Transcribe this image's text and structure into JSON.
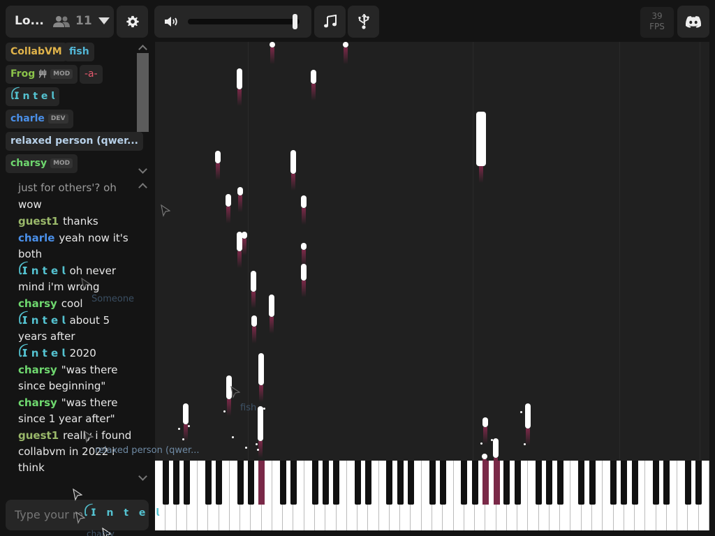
{
  "header": {
    "room_name": "Lo...",
    "user_count": "11",
    "fps_value": "39",
    "fps_label": "FPS",
    "volume_percent": 98
  },
  "icons": {
    "users": "users-icon",
    "dropdown": "chevron-down-icon",
    "settings": "gear-icon",
    "volume": "speaker-icon",
    "instrument": "music-note-icon",
    "midi": "usb-icon",
    "discord": "discord-icon"
  },
  "users": [
    {
      "name": "CollabVM",
      "color": "#e0b34a",
      "badge": ""
    },
    {
      "name": "fish",
      "color": "#52b6d6",
      "badge": ""
    },
    {
      "name": "Frog",
      "color": "#8bc34a",
      "badge": "MOD",
      "flair": "⾋"
    },
    {
      "name": "-a-",
      "color": "#e65a6e",
      "badge": ""
    },
    {
      "name": "ꪶ𝗜 𝗻 𝘁 𝗲 𝗹",
      "color": "#54c2d0",
      "badge": ""
    },
    {
      "name": "charle",
      "color": "#4a8fe8",
      "badge": "DEV"
    },
    {
      "name": "relaxed person (qwer...",
      "color": "#b7d0e8",
      "badge": ""
    },
    {
      "name": "charsy",
      "color": "#6fd86f",
      "badge": "MOD"
    }
  ],
  "chat": [
    {
      "name": "",
      "text": "just for others'? oh",
      "color": "",
      "partial": true
    },
    {
      "name": "",
      "text": "wow",
      "color": ""
    },
    {
      "name": "guest1",
      "text": "thanks",
      "color": "#9ab86a"
    },
    {
      "name": "charle",
      "text": "yeah now it's both",
      "color": "#4a8fe8"
    },
    {
      "name": "ꪶ𝗜 𝗻 𝘁 𝗲 𝗹",
      "text": "oh never mind i'm wrong",
      "color": "#54c2d0"
    },
    {
      "name": "charsy",
      "text": "cool",
      "color": "#6fd86f"
    },
    {
      "name": "ꪶ𝗜 𝗻 𝘁 𝗲 𝗹",
      "text": "about 5 years after",
      "color": "#54c2d0"
    },
    {
      "name": "ꪶ𝗜 𝗻 𝘁 𝗲 𝗹",
      "text": "2020",
      "color": "#54c2d0"
    },
    {
      "name": "charsy",
      "text": "\"was there since beginning\"",
      "color": "#6fd86f"
    },
    {
      "name": "charsy",
      "text": "\"was there since 1 year after\"",
      "color": "#6fd86f"
    },
    {
      "name": "guest1",
      "text": "really i found collabvm in 2022 i think",
      "color": "#9ab86a"
    }
  ],
  "chat_input": {
    "placeholder": "Type your m"
  },
  "cursors": [
    {
      "label": "Someone"
    },
    {
      "label": "fish"
    },
    {
      "label": "relaxed person (qwer..."
    },
    {
      "label": "ꪶ𝗜 𝗻 𝘁 𝗲 𝗹"
    },
    {
      "label": "charsy"
    }
  ]
}
